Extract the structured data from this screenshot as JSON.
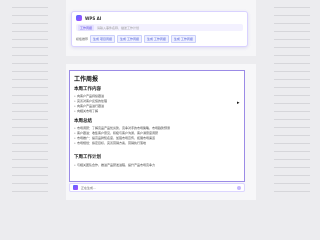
{
  "ai_panel": {
    "title": "WPS AI",
    "mode_tag": "工作周报",
    "placeholder": "请输入事件名称、描述工作计划",
    "chips_label": "模板推荐",
    "chips": [
      "生成 项目周报",
      "生成 工作周报",
      "生成 工作周报",
      "生成 工作周报"
    ]
  },
  "report": {
    "title": "工作周报",
    "sections": [
      {
        "heading": "本周工作内容",
        "items": [
          "向客户产品持续跟进",
          "完善对客户反馈的处理",
          "向客户产品进行跟进",
          "向相关市场了解"
        ]
      },
      {
        "heading": "本周总结",
        "items": [
          "市场调研：了解竞品产品优劣势，竞争对手的市场策略，市场趋势预测",
          "客户跟进：收集客户意见，积极与客户沟通，客户满意度调研",
          "市场推广：提高品牌知名度，加强市场宣传，拓展市场渠道",
          "市场规划：拟定目标，完善营销方案，营销执行落地"
        ]
      },
      {
        "heading": "下周工作计划",
        "items": [
          "与相关团队合作，推进产品研发进程，提升产品市场竞争力"
        ]
      }
    ]
  },
  "bottom_input": {
    "text": "正在生成..."
  },
  "colors": {
    "accent": "#5b47e0",
    "border": "#9b8be6"
  }
}
